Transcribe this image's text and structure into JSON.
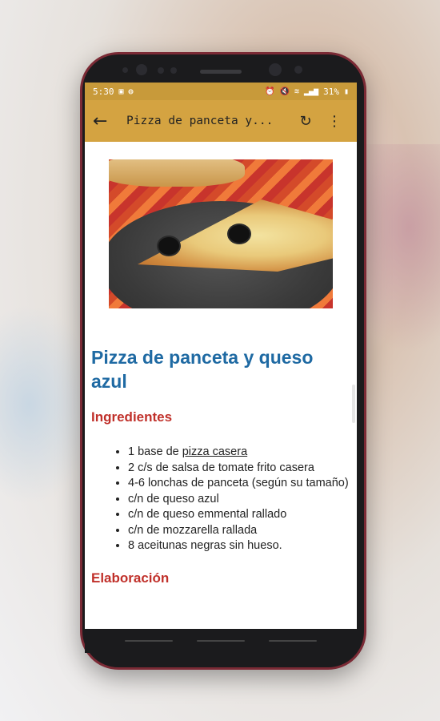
{
  "status_bar": {
    "time": "5:30",
    "battery": "31%",
    "icons": [
      "image-icon",
      "notification-icon",
      "alarm-icon",
      "mute-icon",
      "wifi-icon",
      "signal-icon",
      "battery-icon"
    ]
  },
  "app_bar": {
    "title": "Pizza de panceta y...",
    "back_icon": "arrow-left-icon",
    "refresh_icon": "refresh-icon",
    "menu_icon": "more-vert-icon"
  },
  "recipe": {
    "image_alt": "photo of pizza slice",
    "title": "Pizza de panceta y queso azul",
    "ingredients_heading": "Ingredientes",
    "ingredients": [
      {
        "prefix": "1 base de ",
        "link": "pizza casera",
        "suffix": ""
      },
      {
        "prefix": "2 c/s de salsa de tomate frito casera",
        "link": "",
        "suffix": ""
      },
      {
        "prefix": "4-6 lonchas de panceta (según su tamaño)",
        "link": "",
        "suffix": ""
      },
      {
        "prefix": "c/n de queso azul",
        "link": "",
        "suffix": ""
      },
      {
        "prefix": "c/n de queso emmental rallado",
        "link": "",
        "suffix": ""
      },
      {
        "prefix": "c/n de mozzarella rallada",
        "link": "",
        "suffix": ""
      },
      {
        "prefix": "8 aceitunas negras sin hueso.",
        "link": "",
        "suffix": ""
      }
    ],
    "elaboration_heading": "Elaboración"
  },
  "colors": {
    "status_bar": "#c89a3a",
    "app_bar": "#d4a341",
    "title_blue": "#1f6aa3",
    "heading_red": "#c0302a"
  }
}
